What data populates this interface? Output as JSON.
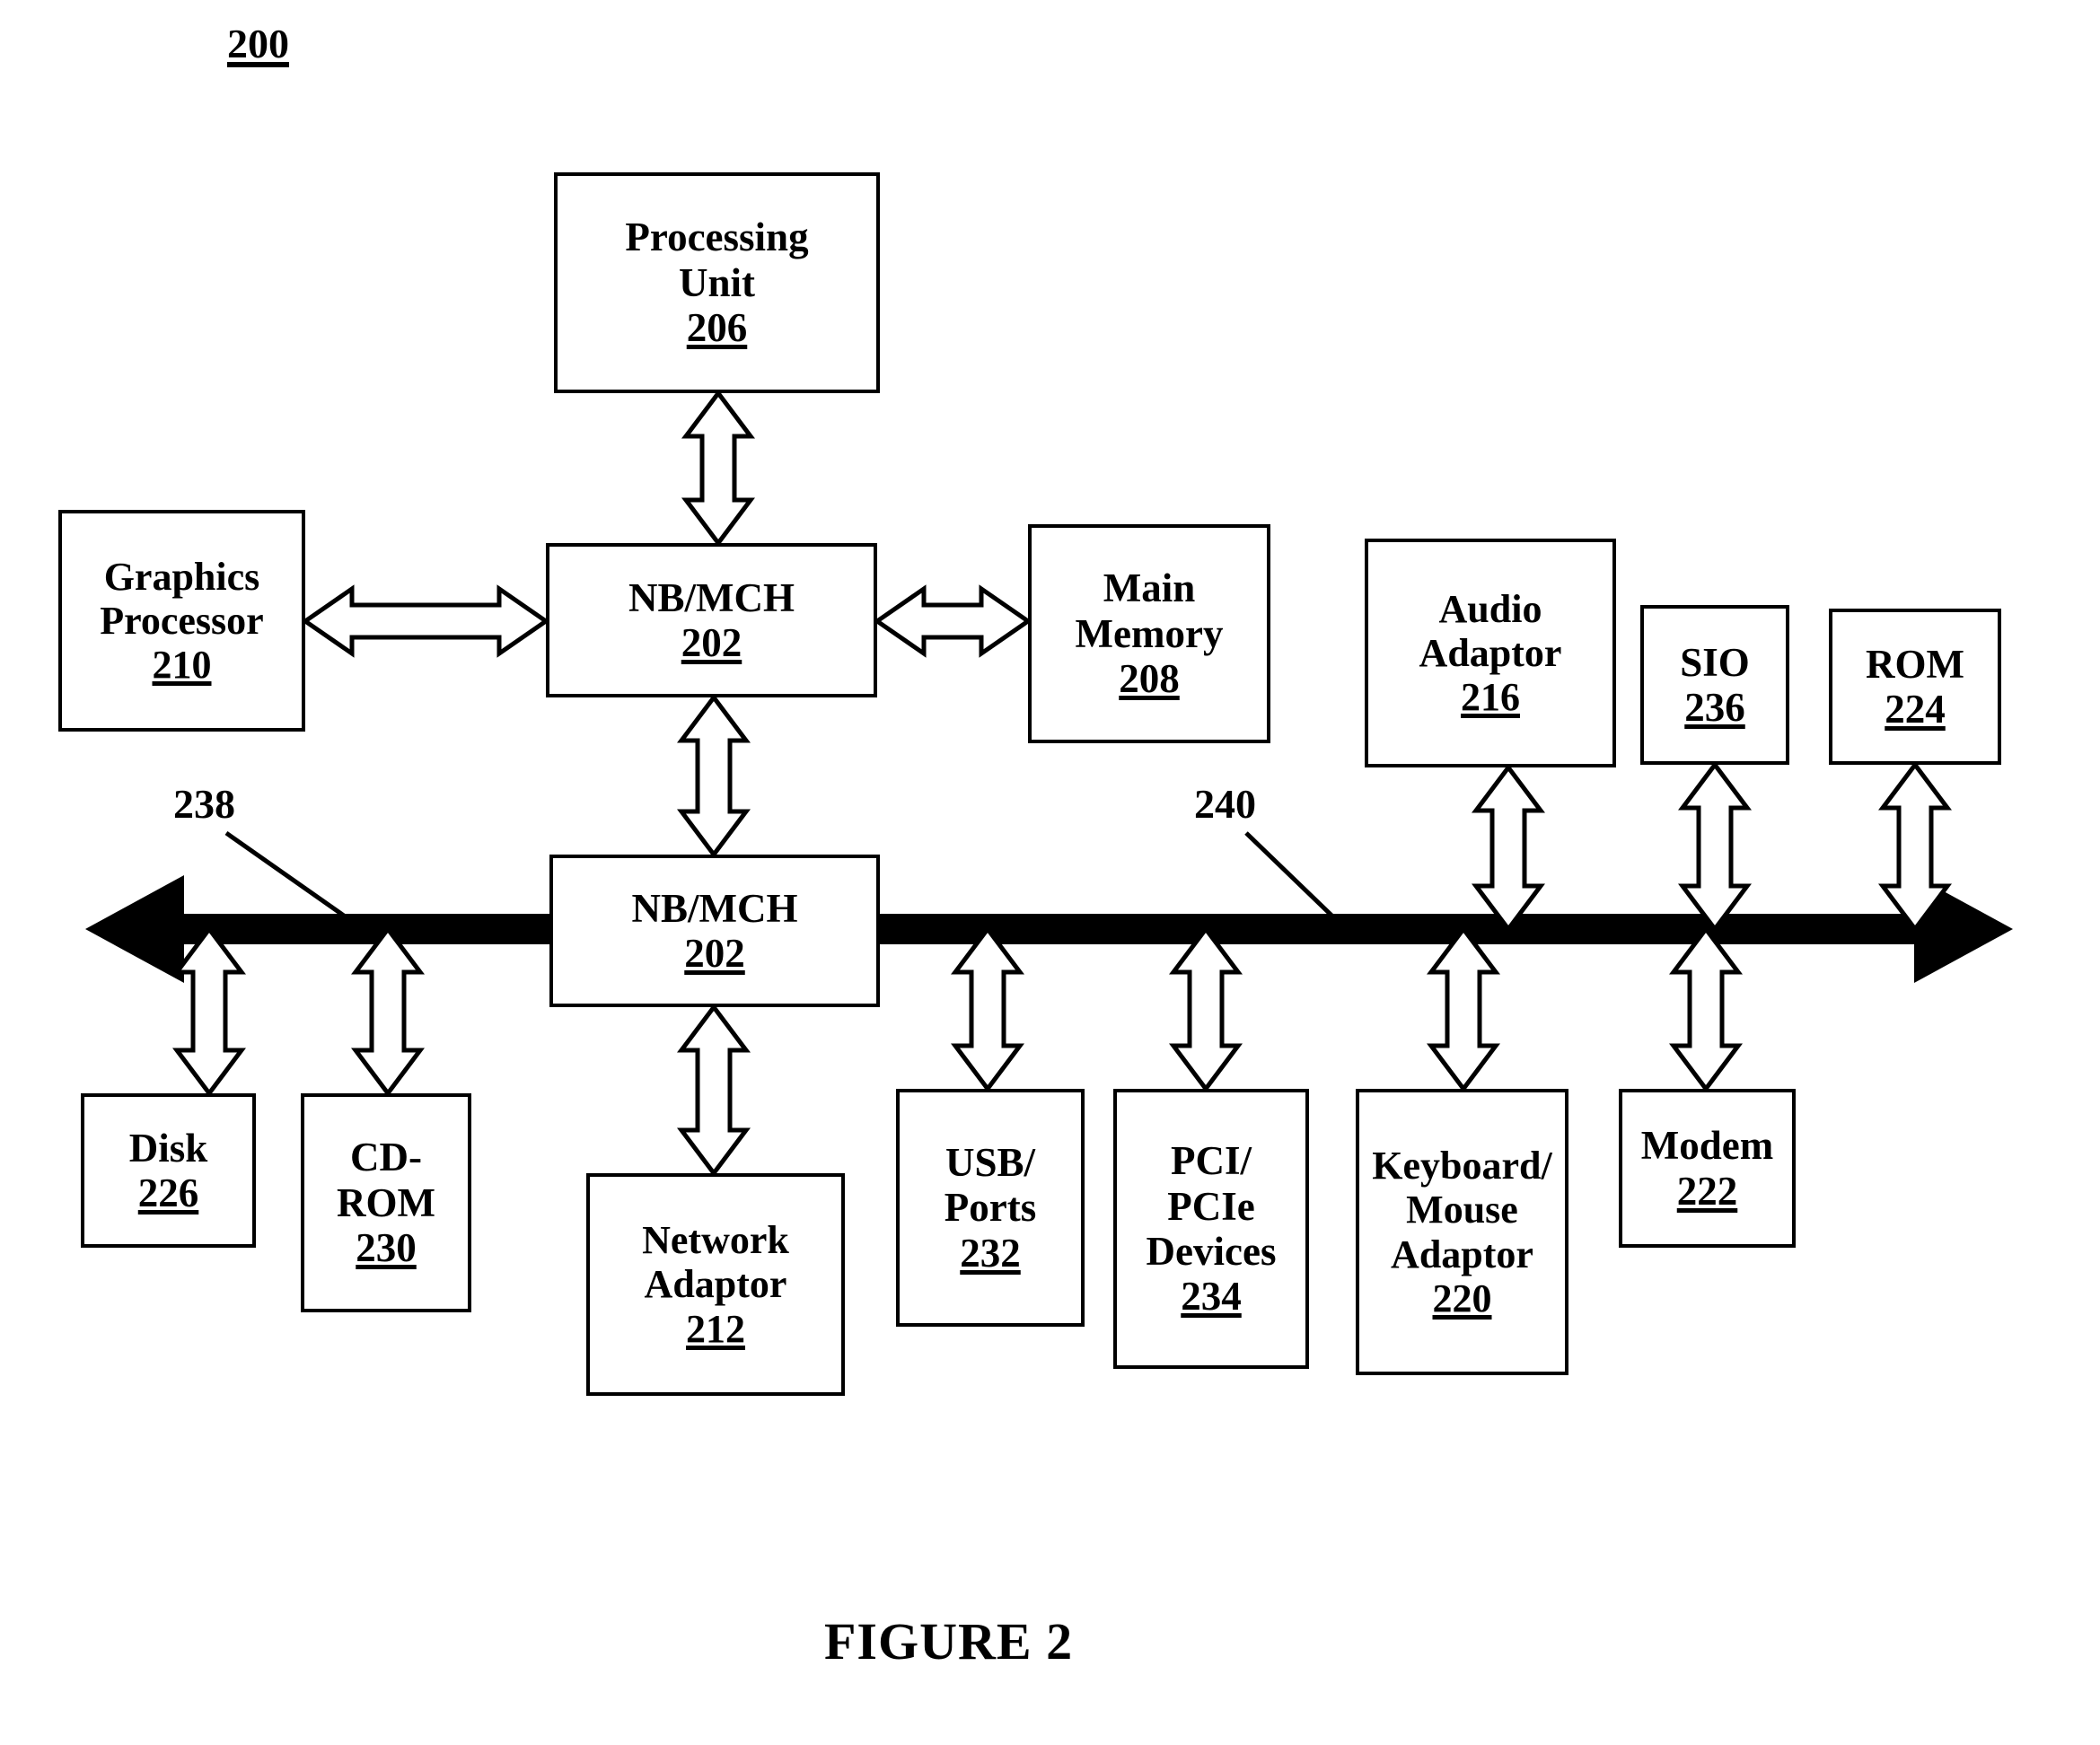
{
  "figure": {
    "diagram_number": "200",
    "caption": "FIGURE 2"
  },
  "blocks": {
    "processing_unit": {
      "line1": "Processing",
      "line2": "Unit",
      "ref": "206"
    },
    "graphics_processor": {
      "line1": "Graphics",
      "line2": "Processor",
      "ref": "210"
    },
    "nb_mch_top": {
      "line1": "NB/MCH",
      "ref": "202"
    },
    "nb_mch_bottom": {
      "line1": "NB/MCH",
      "ref": "202"
    },
    "main_memory": {
      "line1": "Main",
      "line2": "Memory",
      "ref": "208"
    },
    "audio_adaptor": {
      "line1": "Audio",
      "line2": "Adaptor",
      "ref": "216"
    },
    "sio": {
      "line1": "SIO",
      "ref": "236"
    },
    "rom": {
      "line1": "ROM",
      "ref": "224"
    },
    "disk": {
      "line1": "Disk",
      "ref": "226"
    },
    "cdrom": {
      "line1": "CD-",
      "line2": "ROM",
      "ref": "230"
    },
    "network_adaptor": {
      "line1": "Network",
      "line2": "Adaptor",
      "ref": "212"
    },
    "usb_ports": {
      "line1": "USB/",
      "line2": "Ports",
      "ref": "232"
    },
    "pci_devices": {
      "line1": "PCI/",
      "line2": "PCIe",
      "line3": "Devices",
      "ref": "234"
    },
    "keyboard_mouse_adaptor": {
      "line1": "Keyboard/",
      "line2": "Mouse",
      "line3": "Adaptor",
      "ref": "220"
    },
    "modem": {
      "line1": "Modem",
      "ref": "222"
    }
  },
  "bus_labels": {
    "left_bus": "238",
    "right_bus": "240"
  },
  "colors": {
    "ink": "#000000",
    "paper": "#ffffff"
  }
}
